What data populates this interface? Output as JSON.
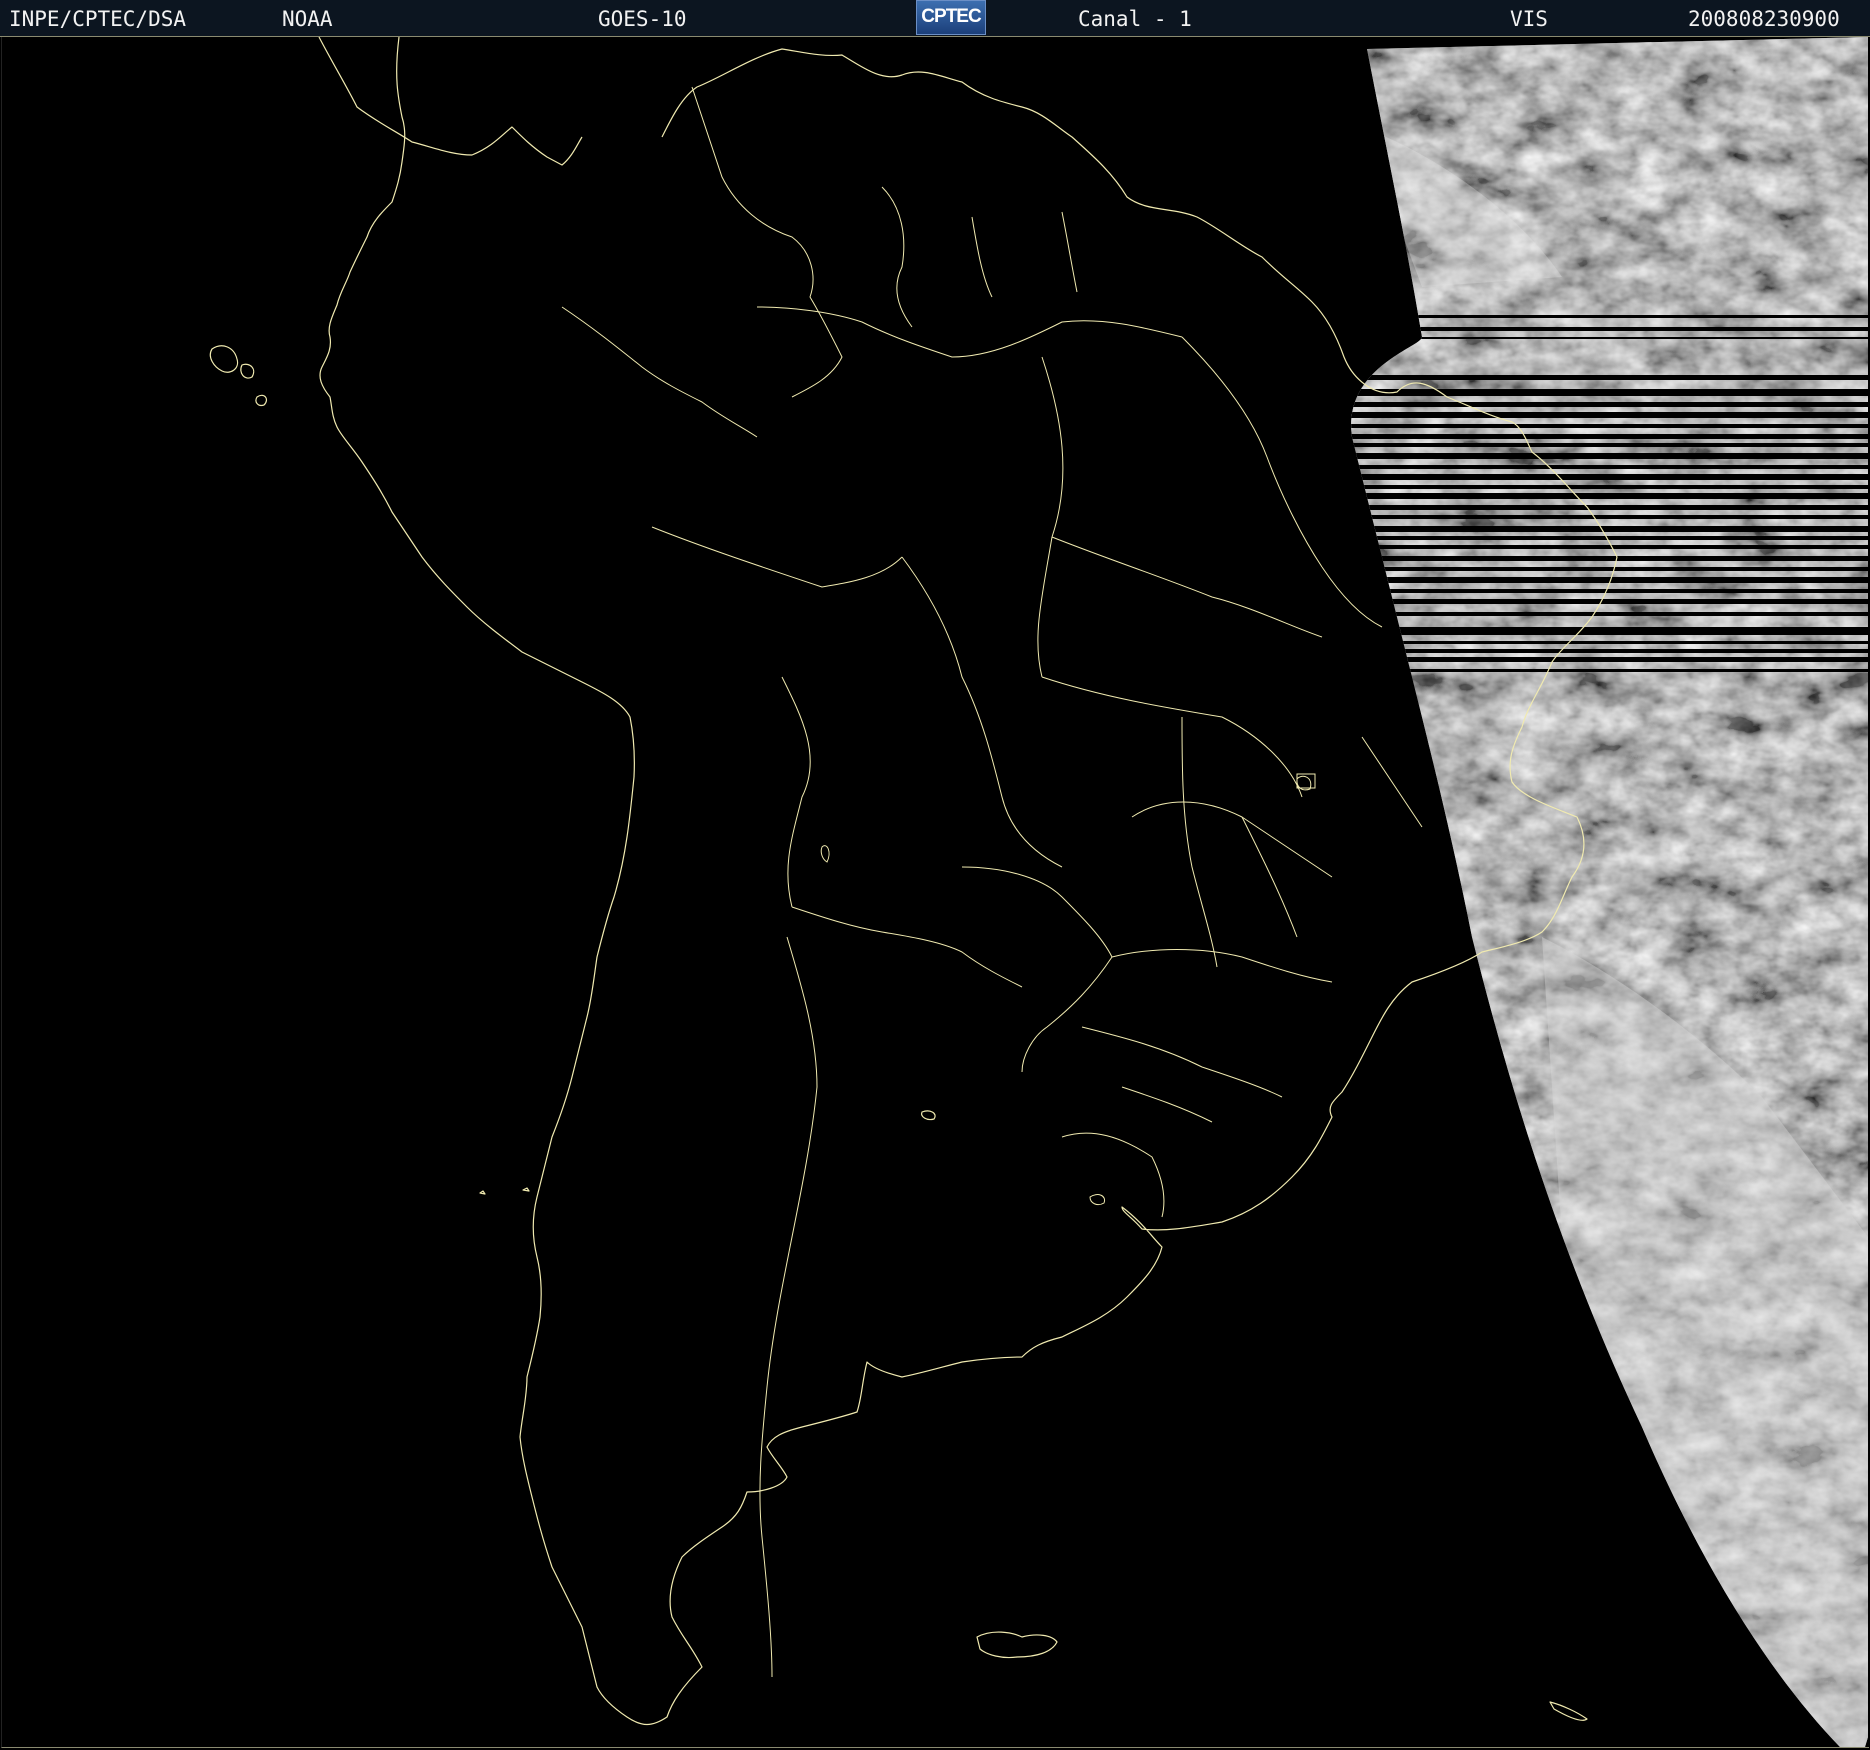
{
  "header": {
    "agency": "INPE/CPTEC/DSA",
    "source": "NOAA",
    "satellite": "GOES-10",
    "logo_text": "CPTEC",
    "channel": "Canal - 1",
    "band": "VIS",
    "timestamp": "200808230900"
  },
  "map": {
    "region": "South America",
    "coastline_color": "#f0eab0",
    "background_color": "#000000",
    "imagery": "visible-channel cloud imagery on the eastern (sunlit) side"
  }
}
